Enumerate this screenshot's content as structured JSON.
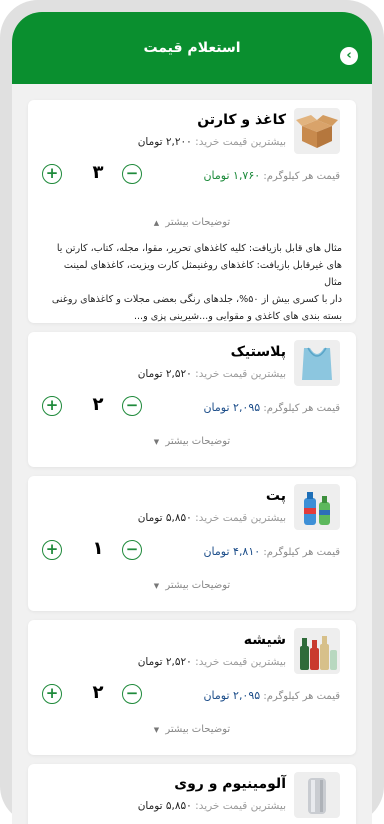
{
  "header": {
    "title": "استعلام قیمت",
    "back_icon": "chevron-left-icon"
  },
  "colors": {
    "brand_green": "#0a8f2f",
    "kg_price_green": "#1b8a3a",
    "kg_price_blue": "#1d4e8a"
  },
  "labels": {
    "max_price_label": "بیشترین قیمت خرید:",
    "kg_price_label": "قیمت هر کیلوگرم:",
    "more_details": "توضیحات بیشتر",
    "plus": "+",
    "minus": "−"
  },
  "items": [
    {
      "title": "کاغذ و کارتن",
      "max_price": "۲,۲۰۰ تومان",
      "kg_price": "۱,۷۶۰ تومان",
      "qty": "۳",
      "icon": "cardboard-box-icon",
      "desc1": "مثال های قابل بازیافت: کلیه کاغذهای تحریر، مقوا، مجله، کتاب، کارتن یا",
      "desc2": "های غیرقابل بازیافت: کاغذهای روغنیمثل کارت ویزیت، کاغذهای لمینت",
      "desc3": "مثال",
      "desc4": "دار با کسری بیش از ۵۰%، جلدهای رنگی بعضی مجلات و کاغذهای روغنی",
      "desc5": "بسته بندی های کاغذی و مقوایی و...شیرینی پزی و..."
    },
    {
      "title": "پلاستیک",
      "max_price": "۲,۵۲۰ تومان",
      "kg_price": "۲,۰۹۵ تومان",
      "qty": "۲",
      "icon": "plastic-bag-icon"
    },
    {
      "title": "پت",
      "max_price": "۵,۸۵۰ تومان",
      "kg_price": "۴,۸۱۰ تومان",
      "qty": "۱",
      "icon": "pet-bottles-icon"
    },
    {
      "title": "شیشه",
      "max_price": "۲,۵۲۰ تومان",
      "kg_price": "۲,۰۹۵ تومان",
      "qty": "۲",
      "icon": "glass-bottles-icon"
    },
    {
      "title": "آلومینیوم و روی",
      "max_price": "۵,۸۵۰ تومان",
      "icon": "aluminum-foil-icon"
    }
  ]
}
